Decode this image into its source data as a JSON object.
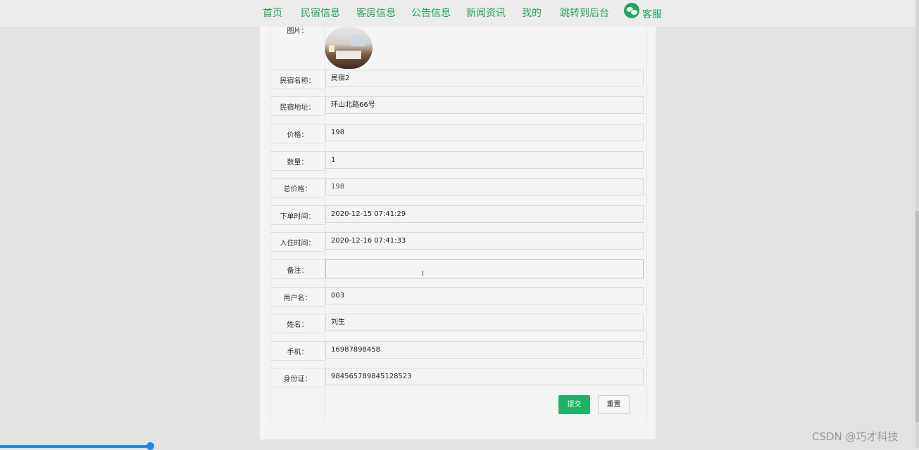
{
  "nav": {
    "items": [
      "首页",
      "民宿信息",
      "客房信息",
      "公告信息",
      "新闻资讯",
      "我的",
      "跳转到后台",
      "客服"
    ]
  },
  "form": {
    "image_label": "图片：",
    "fields": [
      {
        "label": "民宿名称：",
        "value": "民宿2"
      },
      {
        "label": "民宿地址：",
        "value": "环山北路66号"
      },
      {
        "label": "价格：",
        "value": "198"
      },
      {
        "label": "数量：",
        "value": "1"
      },
      {
        "label": "总价格：",
        "value": "198"
      },
      {
        "label": "下单时间：",
        "value": "2020-12-15 07:41:29"
      },
      {
        "label": "入住时间：",
        "value": "2020-12-16 07:41:33"
      },
      {
        "label": "备注：",
        "value": ""
      },
      {
        "label": "用户名：",
        "value": "003"
      },
      {
        "label": "姓名：",
        "value": "刘生"
      },
      {
        "label": "手机：",
        "value": "16987898458"
      },
      {
        "label": "身份证：",
        "value": "984565789845128523"
      }
    ],
    "submit_label": "提交",
    "reset_label": "重置"
  },
  "watermark": "CSDN @巧才科技",
  "progress": {
    "fraction": 0.165
  },
  "colors": {
    "accent": "#22a55a",
    "submit": "#1fb164",
    "progress": "#1e88e5"
  }
}
